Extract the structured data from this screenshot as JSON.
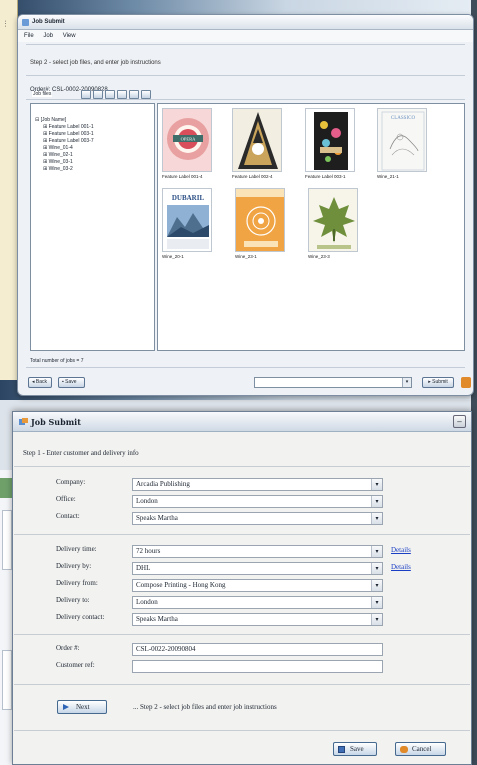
{
  "step2_window": {
    "title": "Job Submit",
    "menu": [
      "File",
      "Job",
      "View"
    ],
    "step_text": "Step 2 - select job files, and enter job instructions",
    "order_line": "Order#: CSL-0002-20090828",
    "job_files_label": "Job files",
    "tree": {
      "root": "[Job Name]",
      "children": [
        "Feature Label 001-1",
        "Feature Label 003-1",
        "Feature Label 003-7",
        "Wine_01-4",
        "Wine_02-1",
        "Wine_03-1",
        "Wine_03-2"
      ]
    },
    "thumbnails": [
      {
        "caption": "Feature Label 001-4",
        "art": "OPERA",
        "color": "#e8a0a0"
      },
      {
        "caption": "Feature Label 002-4",
        "art": "",
        "color": "#d9c08c"
      },
      {
        "caption": "Feature Label 003-1",
        "art": "",
        "color": "#1e1e1e"
      },
      {
        "caption": "Wine_21-1",
        "art": "CLASSICO",
        "color": "#f4f4f4"
      },
      {
        "caption": "Wine_20-1",
        "art": "DUBARIL",
        "color": "#5d7fa4"
      },
      {
        "caption": "Wine_23-1",
        "art": "",
        "color": "#f0a443"
      },
      {
        "caption": "Wine_23-3",
        "art": "",
        "color": "#f7f4e9"
      }
    ],
    "total_jobs": "Total number of jobs = 7",
    "back_label": "Back",
    "save_label": "Save",
    "submit_label": "Submit"
  },
  "step1_window": {
    "title": "Job Submit",
    "step_text": "Step 1 - Enter customer and delivery info",
    "fields_customer": [
      {
        "label": "Company:",
        "value": "Arcadia Publishing"
      },
      {
        "label": "Office:",
        "value": "London"
      },
      {
        "label": "Contact:",
        "value": "Speaks Martha"
      }
    ],
    "fields_delivery": [
      {
        "label": "Delivery time:",
        "value": "72 hours",
        "link": "Details"
      },
      {
        "label": "Delivery by:",
        "value": "DHL",
        "link": "Details"
      },
      {
        "label": "Delivery from:",
        "value": "Compose Printing - Hong Kong",
        "link": ""
      },
      {
        "label": "Delivery to:",
        "value": "London",
        "link": ""
      },
      {
        "label": "Delivery contact:",
        "value": "Speaks Martha",
        "link": ""
      }
    ],
    "order": {
      "label": "Order #:",
      "value": "CSL-0022-20090804"
    },
    "customer_ref": {
      "label": "Customer ref:",
      "value": ""
    },
    "next_label": "Next",
    "next_hint": "... Step 2 - select job files and enter job instructions",
    "save_label": "Save",
    "cancel_label": "Cancel"
  },
  "colors": {
    "link": "#1a3ec4",
    "accent": "#2d64b6"
  }
}
